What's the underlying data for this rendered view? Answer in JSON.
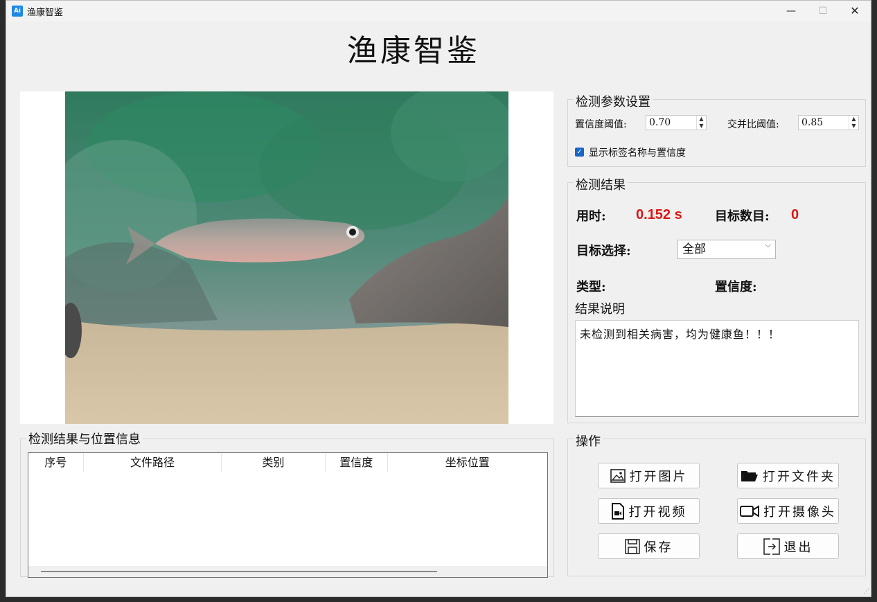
{
  "window": {
    "title": "渔康智鉴",
    "icon_text": "Ai",
    "minimize": "—",
    "maximize": "☐",
    "close": "✕"
  },
  "main_title": "渔康智鉴",
  "image_panel": {
    "content": "fish-photo"
  },
  "table_group": {
    "title": "检测结果与位置信息",
    "columns": [
      "序号",
      "文件路径",
      "类别",
      "置信度",
      "坐标位置"
    ],
    "rows": []
  },
  "params": {
    "title": "检测参数设置",
    "confidence_label": "置信度阈值:",
    "confidence_value": "0.70",
    "iou_label": "交并比阈值:",
    "iou_value": "0.85",
    "show_labels_text": "显示标签名称与置信度",
    "show_labels_checked": true
  },
  "results": {
    "title": "检测结果",
    "time_label": "用时:",
    "time_value": "0.152 s",
    "count_label": "目标数目:",
    "count_value": "0",
    "target_select_label": "目标选择:",
    "target_select_value": "全部",
    "type_label": "类型:",
    "confidence_label": "置信度:",
    "description_title": "结果说明",
    "description_text": "未检测到相关病害，均为健康鱼！！！"
  },
  "ops": {
    "title": "操作",
    "buttons": {
      "open_image": "打开图片",
      "open_folder": "打开文件夹",
      "open_video": "打开视频",
      "open_camera": "打开摄像头",
      "save": "保存",
      "exit": "退出"
    }
  },
  "colors": {
    "accent": "#1a66c5",
    "result_red": "#e01515"
  }
}
